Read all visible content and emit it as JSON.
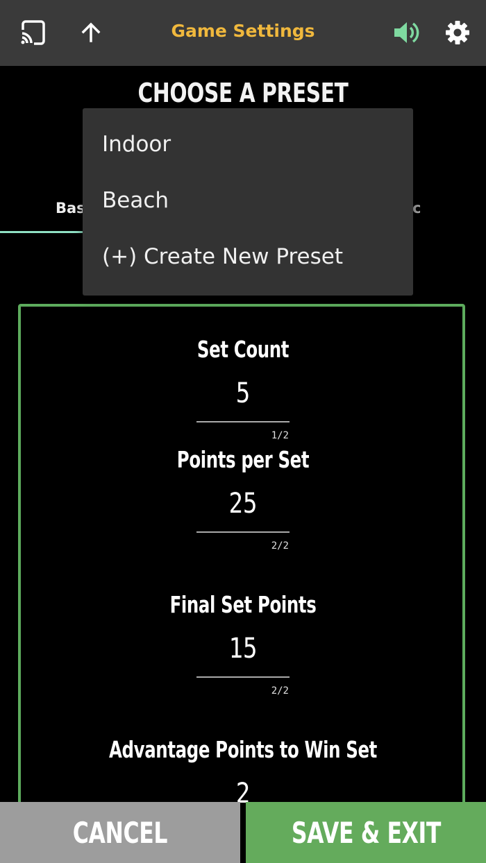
{
  "header": {
    "title": "Game Settings",
    "icons": {
      "cast": "cast-icon",
      "up": "arrow-up-icon",
      "sound": "volume-icon",
      "settings": "gear-icon"
    },
    "colors": {
      "bar": "#3a3a3a",
      "title": "#f0b83d",
      "sound": "#7fd9a0"
    }
  },
  "preset": {
    "heading": "CHOOSE A PRESET"
  },
  "tabs": [
    {
      "label": "Bas"
    },
    {
      "label": "c"
    }
  ],
  "dropdown": {
    "items": [
      {
        "label": "Indoor"
      },
      {
        "label": "Beach"
      },
      {
        "label": "(+) Create New Preset"
      }
    ]
  },
  "settings": [
    {
      "label": "Set Count",
      "value": "5",
      "counter": "1/2"
    },
    {
      "label": "Points per Set",
      "value": "25",
      "counter": "2/2"
    },
    {
      "label": "Final Set Points",
      "value": "15",
      "counter": "2/2"
    },
    {
      "label": "Advantage Points to Win Set",
      "value": "2"
    }
  ],
  "buttons": {
    "cancel": "CANCEL",
    "save": "SAVE & EXIT"
  },
  "colors": {
    "panel_border": "#5dab5d",
    "cancel_bg": "#9d9d9d",
    "save_bg": "#64ab5c",
    "tab_indicator": "#8fe0c4"
  }
}
